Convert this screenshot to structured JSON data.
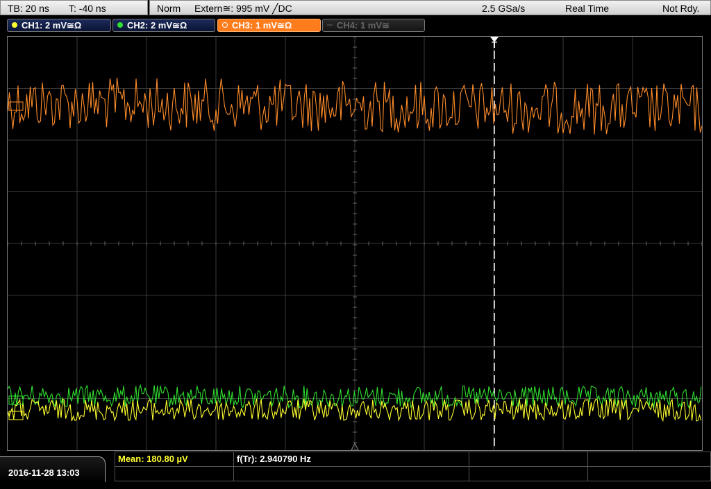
{
  "timebase": {
    "tb": "TB: 20 ns",
    "t": "T: -40 ns"
  },
  "trigger": {
    "mode": "Norm",
    "source": "Extern≅: 995 mV ╱DC",
    "sample_rate": "2.5 GSa/s",
    "acq_mode": "Real Time",
    "status": "Not Rdy."
  },
  "channels": [
    {
      "label": "CH1: 2 mV≅Ω",
      "color": "#ffff30",
      "state": "on"
    },
    {
      "label": "CH2: 2 mV≅Ω",
      "color": "#30e030",
      "state": "on"
    },
    {
      "label": "CH3: 1 mV≅Ω",
      "color": "#ff8c2a",
      "state": "active"
    },
    {
      "label": "CH4: 1 mV≅",
      "color": "#555555",
      "state": "off"
    }
  ],
  "trigger_marker": "T",
  "measurements": {
    "mean": "Mean: 180.80 µV",
    "freq": "f(Tr): 2.940790 Hz"
  },
  "datetime": "2016-11-28 13:03",
  "colors": {
    "ch1": "#ffff30",
    "ch2": "#30e030",
    "ch3": "#ff8c2a",
    "grid": "#3a3a3a"
  }
}
